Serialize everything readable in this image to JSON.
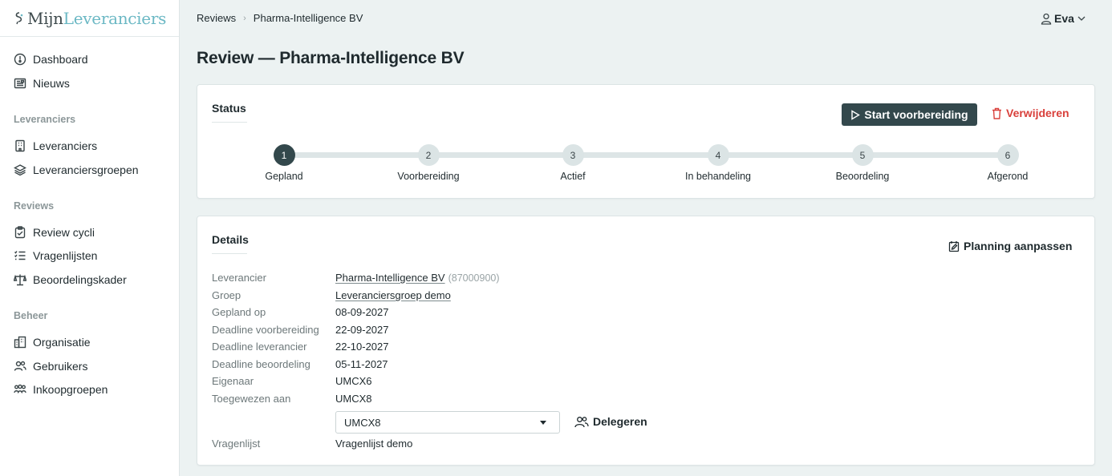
{
  "brand": {
    "name_part1": "Mijn",
    "name_part2": "Leveranciers"
  },
  "sidebar": {
    "main": [
      {
        "label": "Dashboard",
        "icon": "dashboard-icon"
      },
      {
        "label": "Nieuws",
        "icon": "newspaper-icon"
      }
    ],
    "sections": [
      {
        "title": "Leveranciers",
        "items": [
          {
            "label": "Leveranciers",
            "icon": "building-icon"
          },
          {
            "label": "Leveranciersgroepen",
            "icon": "layers-icon"
          }
        ]
      },
      {
        "title": "Reviews",
        "items": [
          {
            "label": "Review cycli",
            "icon": "clipboard-check-icon"
          },
          {
            "label": "Vragenlijsten",
            "icon": "checklist-icon"
          },
          {
            "label": "Beoordelingskader",
            "icon": "scale-icon"
          }
        ]
      },
      {
        "title": "Beheer",
        "items": [
          {
            "label": "Organisatie",
            "icon": "organization-icon"
          },
          {
            "label": "Gebruikers",
            "icon": "users-icon"
          },
          {
            "label": "Inkoopgroepen",
            "icon": "groups-icon"
          }
        ]
      }
    ]
  },
  "breadcrumb": {
    "parent": "Reviews",
    "current": "Pharma-Intelligence BV"
  },
  "user": {
    "name": "Eva"
  },
  "page": {
    "title": "Review — Pharma-Intelligence BV"
  },
  "status_card": {
    "title": "Status",
    "start_button": "Start voorbereiding",
    "delete_button": "Verwijderen",
    "current_step": 1,
    "steps": [
      {
        "number": "1",
        "label": "Gepland"
      },
      {
        "number": "2",
        "label": "Voorbereiding"
      },
      {
        "number": "3",
        "label": "Actief"
      },
      {
        "number": "4",
        "label": "In behandeling"
      },
      {
        "number": "5",
        "label": "Beoordeling"
      },
      {
        "number": "6",
        "label": "Afgerond"
      }
    ]
  },
  "details_card": {
    "title": "Details",
    "planning_button": "Planning aanpassen",
    "rows": [
      {
        "label": "Leverancier",
        "value": "Pharma-Intelligence BV",
        "extra": "(87000900)"
      },
      {
        "label": "Groep",
        "value": "Leveranciersgroep demo"
      },
      {
        "label": "Gepland op",
        "value": "08-09-2027"
      },
      {
        "label": "Deadline voorbereiding",
        "value": "22-09-2027"
      },
      {
        "label": "Deadline leverancier",
        "value": "22-10-2027"
      },
      {
        "label": "Deadline beoordeling",
        "value": "05-11-2027"
      },
      {
        "label": "Eigenaar",
        "value": "UMCX6"
      },
      {
        "label": "Toegewezen aan",
        "value": "UMCX8"
      },
      {
        "label": "Vragenlijst",
        "value": "Vragenlijst demo"
      }
    ],
    "assignee_select": "UMCX8",
    "delegate_button": "Delegeren"
  }
}
